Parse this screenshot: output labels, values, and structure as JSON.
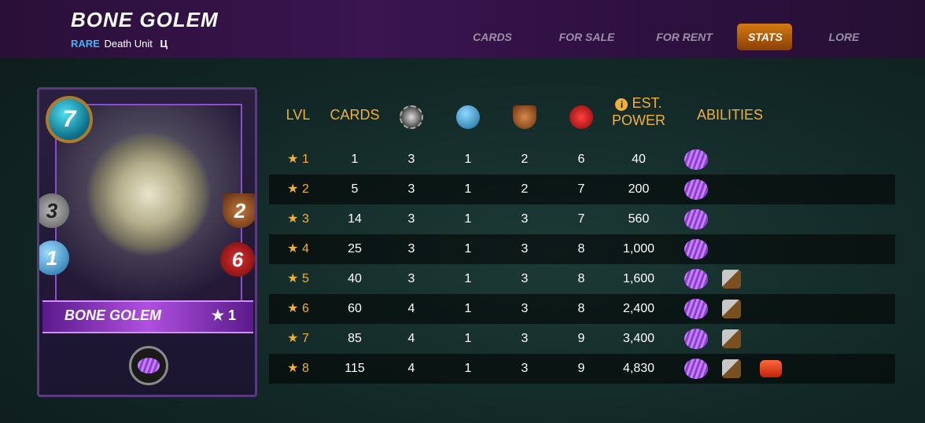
{
  "header": {
    "title": "BONE GOLEM",
    "rarity": "RARE",
    "unit_type": "Death Unit",
    "edition_icon": "Ц",
    "tabs": [
      {
        "label": "CARDS",
        "active": false
      },
      {
        "label": "FOR SALE",
        "active": false
      },
      {
        "label": "FOR RENT",
        "active": false
      },
      {
        "label": "STATS",
        "active": true
      },
      {
        "label": "LORE",
        "active": false
      }
    ]
  },
  "card": {
    "mana": "7",
    "attack": "3",
    "armor": "2",
    "speed": "1",
    "health": "6",
    "name": "BONE GOLEM",
    "level": "★ 1",
    "ability_icon": "void-ability-icon"
  },
  "table": {
    "headers": {
      "lvl": "LVL",
      "cards": "CARDS",
      "attack_icon": "melee-attack-icon",
      "speed_icon": "speed-icon",
      "armor_icon": "armor-shield-icon",
      "health_icon": "health-heart-icon",
      "power_line1": "EST.",
      "power_line2": "POWER",
      "abilities": "ABILITIES"
    },
    "rows": [
      {
        "lvl": "★ 1",
        "cards": "1",
        "attack": "3",
        "speed": "1",
        "armor": "2",
        "health": "6",
        "power": "40",
        "abilities": [
          "void"
        ]
      },
      {
        "lvl": "★ 2",
        "cards": "5",
        "attack": "3",
        "speed": "1",
        "armor": "2",
        "health": "7",
        "power": "200",
        "abilities": [
          "void"
        ]
      },
      {
        "lvl": "★ 3",
        "cards": "14",
        "attack": "3",
        "speed": "1",
        "armor": "3",
        "health": "7",
        "power": "560",
        "abilities": [
          "void"
        ]
      },
      {
        "lvl": "★ 4",
        "cards": "25",
        "attack": "3",
        "speed": "1",
        "armor": "3",
        "health": "8",
        "power": "1,000",
        "abilities": [
          "void"
        ]
      },
      {
        "lvl": "★ 5",
        "cards": "40",
        "attack": "3",
        "speed": "1",
        "armor": "3",
        "health": "8",
        "power": "1,600",
        "abilities": [
          "void",
          "demoralize"
        ]
      },
      {
        "lvl": "★ 6",
        "cards": "60",
        "attack": "4",
        "speed": "1",
        "armor": "3",
        "health": "8",
        "power": "2,400",
        "abilities": [
          "void",
          "demoralize"
        ]
      },
      {
        "lvl": "★ 7",
        "cards": "85",
        "attack": "4",
        "speed": "1",
        "armor": "3",
        "health": "9",
        "power": "3,400",
        "abilities": [
          "void",
          "demoralize"
        ]
      },
      {
        "lvl": "★ 8",
        "cards": "115",
        "attack": "4",
        "speed": "1",
        "armor": "3",
        "health": "9",
        "power": "4,830",
        "abilities": [
          "void",
          "demoralize",
          "enrage"
        ]
      }
    ]
  },
  "colors": {
    "accent_gold": "#f0b03a",
    "rarity_blue": "#3fb6ff",
    "active_tab": "#d47b12"
  }
}
